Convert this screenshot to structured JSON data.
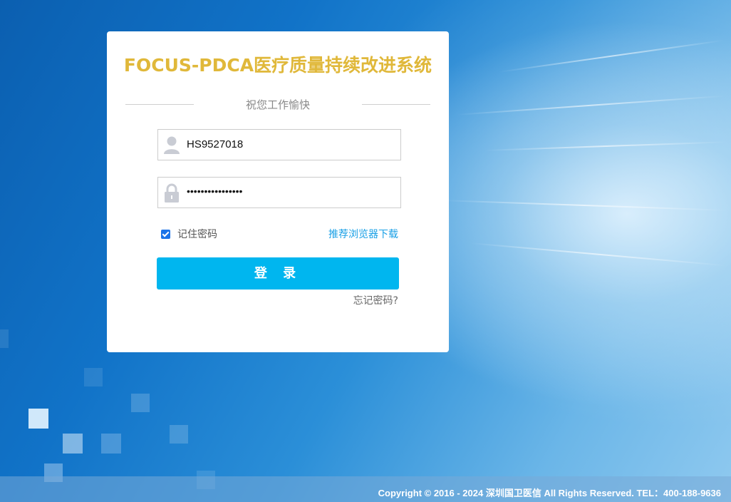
{
  "app": {
    "title": "FOCUS-PDCA医疗质量持续改进系统",
    "greeting": "祝您工作愉快"
  },
  "form": {
    "username_value": "HS9527018",
    "password_value": "••••••••••••••••",
    "remember_label": "记住密码",
    "remember_checked": true,
    "browser_link": "推荐浏览器下载",
    "login_label": "登 录",
    "forgot_label": "忘记密码?"
  },
  "footer": {
    "copyright": "Copyright © 2016 - 2024 深圳国卫医信 All Rights Reserved. TEL：400-188-9636"
  },
  "colors": {
    "title": "#e0b83a",
    "button": "#00b6ef",
    "link": "#1aa0e6",
    "checkbox": "#1a73e8"
  },
  "icons": {
    "username": "user-icon",
    "password": "lock-icon"
  }
}
